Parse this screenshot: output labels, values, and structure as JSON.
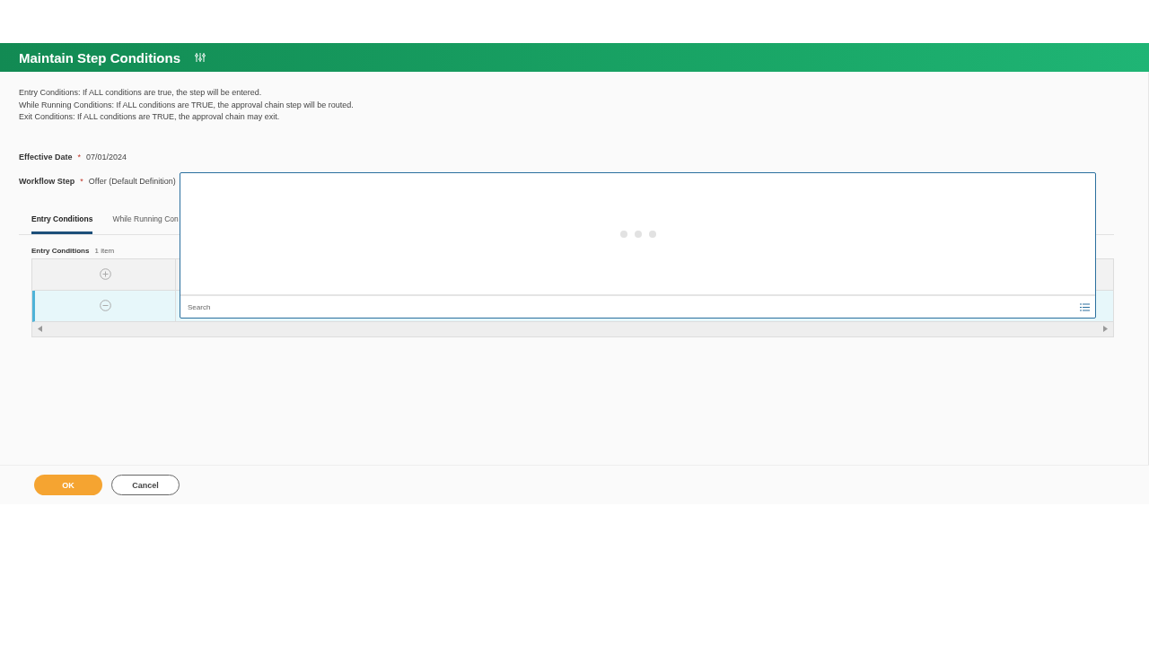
{
  "header": {
    "title": "Maintain Step Conditions"
  },
  "instructions": [
    "Entry Conditions: If ALL conditions are true, the step will be entered.",
    "While Running Conditions: If ALL conditions are TRUE, the approval chain step will be routed.",
    "Exit Conditions:  If ALL conditions are TRUE, the approval chain may exit."
  ],
  "fields": [
    {
      "label": "Effective Date",
      "required_mark": "*",
      "value": "07/01/2024"
    },
    {
      "label": "Workflow Step",
      "required_mark": "*",
      "value": "Offer (Default Definition)"
    }
  ],
  "tabs": [
    {
      "label": "Entry Conditions",
      "selected": true
    },
    {
      "label": "While Running Con",
      "selected": false
    }
  ],
  "grid": {
    "title": "Entry Conditions",
    "count": "1 item",
    "rows": [
      {
        "kind": "add",
        "selected": false
      },
      {
        "kind": "remove",
        "selected": true
      }
    ]
  },
  "popup": {
    "loading": true,
    "search": {
      "placeholder": "Search"
    }
  },
  "buttons": [
    {
      "label": "OK",
      "kind": "primary"
    },
    {
      "label": "Cancel",
      "kind": "secondary"
    }
  ]
}
